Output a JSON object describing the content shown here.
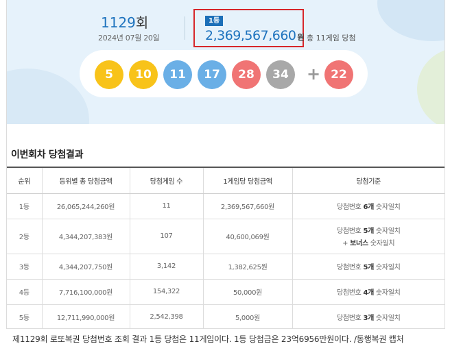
{
  "draw": {
    "number": "1129",
    "suffix": "회",
    "date": "2024년 07월 20일"
  },
  "first_prize": {
    "badge": "1등",
    "amount": "2,369,567,660",
    "unit": "원",
    "winners_text": "총 11게임 당첨"
  },
  "numbers": [
    {
      "value": "5",
      "color": "#f8c31a"
    },
    {
      "value": "10",
      "color": "#f8c31a"
    },
    {
      "value": "11",
      "color": "#6aafe6"
    },
    {
      "value": "17",
      "color": "#6aafe6"
    },
    {
      "value": "28",
      "color": "#f07474"
    },
    {
      "value": "34",
      "color": "#a8a8a8"
    }
  ],
  "plus_sign": "+",
  "bonus": {
    "value": "22",
    "color": "#f07474"
  },
  "section_title": "이번회차 당첨결과",
  "table": {
    "headers": [
      "순위",
      "등위별 총 당첨금액",
      "당첨게임 수",
      "1게임당 당첨금액",
      "당첨기준"
    ],
    "rows": [
      {
        "rank": "1등",
        "total": "26,065,244,260원",
        "games": "11",
        "per_game": "2,369,567,660원",
        "criteria_pre": "당첨번호 ",
        "criteria_bold": "6개",
        "criteria_post": " 숫자일치",
        "bonus_pre": "",
        "bonus_bold": "",
        "bonus_post": ""
      },
      {
        "rank": "2등",
        "total": "4,344,207,383원",
        "games": "107",
        "per_game": "40,600,069원",
        "criteria_pre": "당첨번호 ",
        "criteria_bold": "5개",
        "criteria_post": " 숫자일치",
        "bonus_pre": "+ ",
        "bonus_bold": "보너스",
        "bonus_post": " 숫자일치"
      },
      {
        "rank": "3등",
        "total": "4,344,207,750원",
        "games": "3,142",
        "per_game": "1,382,625원",
        "criteria_pre": "당첨번호 ",
        "criteria_bold": "5개",
        "criteria_post": " 숫자일치",
        "bonus_pre": "",
        "bonus_bold": "",
        "bonus_post": ""
      },
      {
        "rank": "4등",
        "total": "7,716,100,000원",
        "games": "154,322",
        "per_game": "50,000원",
        "criteria_pre": "당첨번호 ",
        "criteria_bold": "4개",
        "criteria_post": " 숫자일치",
        "bonus_pre": "",
        "bonus_bold": "",
        "bonus_post": ""
      },
      {
        "rank": "5등",
        "total": "12,711,990,000원",
        "games": "2,542,398",
        "per_game": "5,000원",
        "criteria_pre": "당첨번호 ",
        "criteria_bold": "3개",
        "criteria_post": " 숫자일치",
        "bonus_pre": "",
        "bonus_bold": "",
        "bonus_post": ""
      }
    ]
  },
  "caption": "제1129회 로또복권 당첨번호 조회 결과 1등 당첨은 11게임이다. 1등 당첨금은 23억6956만원이다. /동행복권 캡처"
}
